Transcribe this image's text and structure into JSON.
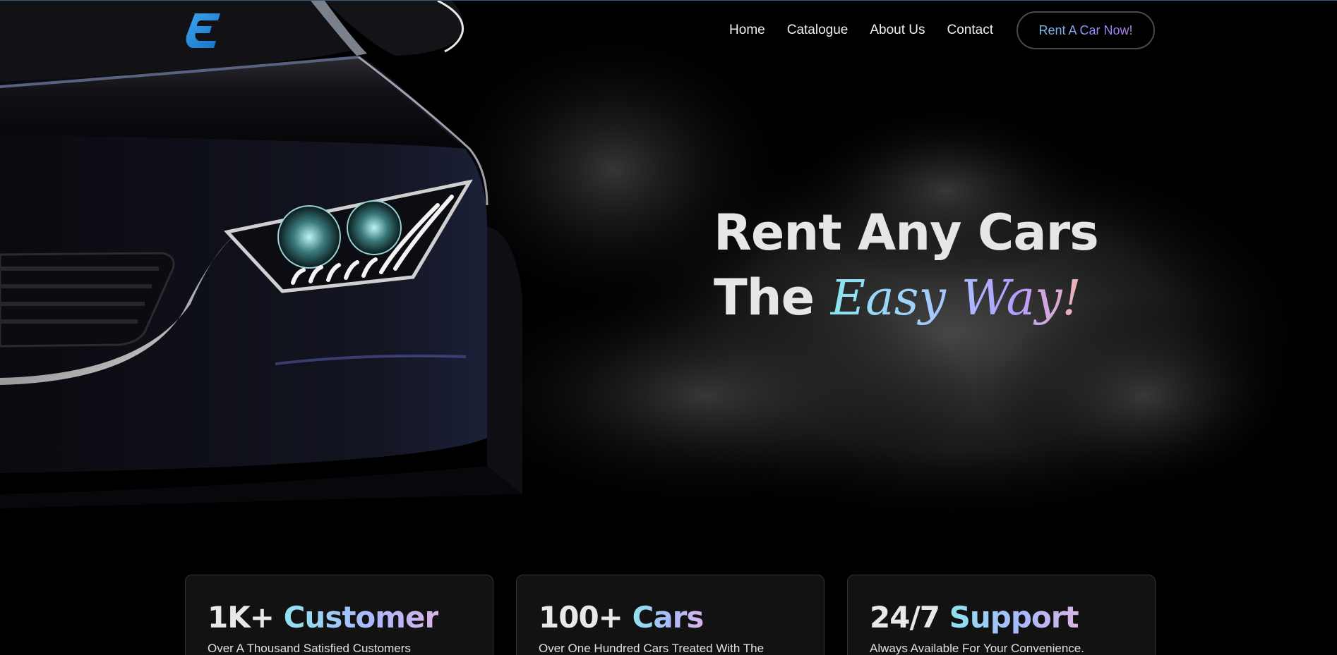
{
  "nav": {
    "links": [
      "Home",
      "Catalogue",
      "About Us",
      "Contact"
    ],
    "cta_label": "Rent A Car Now!"
  },
  "hero": {
    "line1": "Rent Any Cars",
    "line2_prefix": "The",
    "line2_accent": "Easy Way!"
  },
  "stats": [
    {
      "number": "1K+",
      "word": "Customer",
      "desc": "Over A Thousand Satisfied Customers"
    },
    {
      "number": "100+",
      "word": "Cars",
      "desc": "Over One Hundred Cars Treated With The"
    },
    {
      "number": "24/7",
      "word": "Support",
      "desc": "Always Available For Your Convenience."
    }
  ],
  "colors": {
    "background": "#000000",
    "logo_blue": "#2a8ee0",
    "accent_cyan": "#8fe3ee",
    "accent_violet": "#a9b8ff"
  },
  "icons": {
    "logo": "brand-logo-e"
  }
}
